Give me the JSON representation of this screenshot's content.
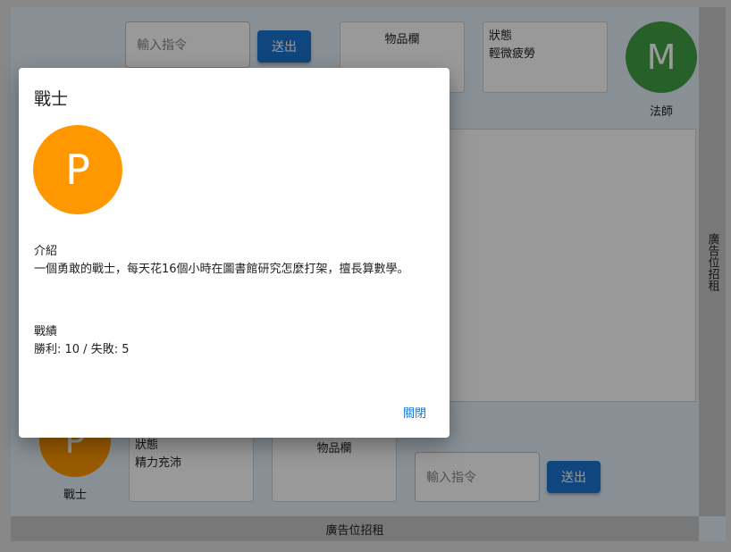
{
  "top_player": {
    "input_placeholder": "輸入指令",
    "send_label": "送出",
    "inventory_title": "物品欄",
    "status_title": "狀態",
    "status_value": "輕微疲勞",
    "avatar_letter": "M",
    "avatar_color": "#43a047",
    "name": "法師"
  },
  "bottom_player": {
    "avatar_letter": "P",
    "avatar_color": "#ff9800",
    "name": "戰士",
    "status_title": "狀態",
    "status_value": "精力充沛",
    "inventory_title": "物品欄",
    "input_placeholder": "輸入指令",
    "send_label": "送出"
  },
  "ads": {
    "right": "廣告位招租",
    "bottom": "廣告位招租"
  },
  "dialog": {
    "title": "戰士",
    "avatar_letter": "P",
    "avatar_color": "#ff9800",
    "intro_heading": "介紹",
    "intro_text": "一個勇敢的戰士，每天花16個小時在圖書館研究怎麼打架，擅長算數學。",
    "record_heading": "戰績",
    "record_text": "勝利: 10 / 失敗: 5",
    "close_label": "關閉"
  },
  "colors": {
    "primary": "#1976d2",
    "app_background": "#e3f1fb",
    "ad_background": "#c9c9c9"
  }
}
